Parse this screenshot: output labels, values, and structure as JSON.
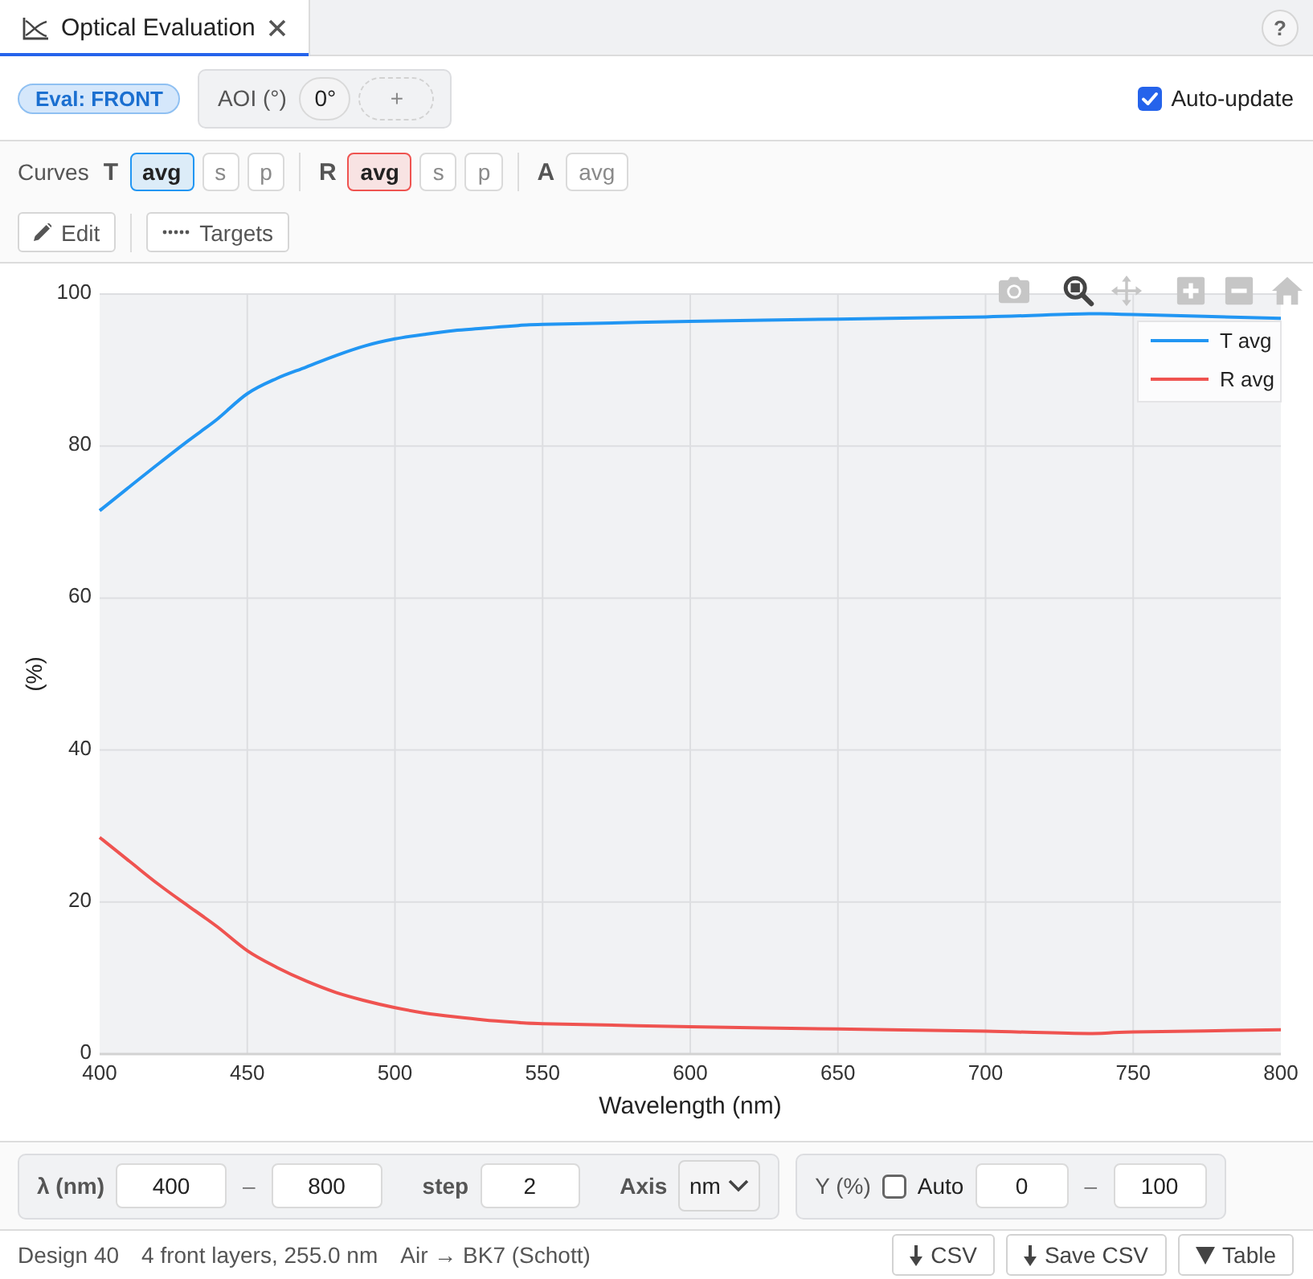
{
  "tabs": [
    {
      "label": "Optical Evaluation",
      "selected": true
    }
  ],
  "help_button": {
    "label": "?"
  },
  "eval_badge": "Eval: FRONT",
  "aoi": {
    "label": "AOI (°)",
    "angles": [
      "0°"
    ],
    "add_label": "+"
  },
  "auto_update": {
    "label": "Auto-update",
    "checked": true
  },
  "curves": {
    "label": "Curves",
    "groups": [
      {
        "name": "T",
        "color": "#2196f3",
        "options": [
          {
            "label": "avg",
            "selected": true
          },
          {
            "label": "s",
            "selected": false
          },
          {
            "label": "p",
            "selected": false
          }
        ]
      },
      {
        "name": "R",
        "color": "#ef5350",
        "options": [
          {
            "label": "avg",
            "selected": true
          },
          {
            "label": "s",
            "selected": false
          },
          {
            "label": "p",
            "selected": false
          }
        ]
      },
      {
        "name": "A",
        "options": [
          {
            "label": "avg",
            "selected": false
          }
        ]
      }
    ]
  },
  "actions": [
    {
      "kind": "edit",
      "label": "Edit"
    },
    {
      "kind": "targets",
      "label": "Targets"
    }
  ],
  "chart": {
    "tools": [
      {
        "kind": "camera",
        "selected": false
      },
      {
        "kind": "zoom",
        "selected": true
      },
      {
        "kind": "pan",
        "selected": false
      },
      {
        "kind": "zoom_in",
        "selected": false
      },
      {
        "kind": "zoom_out",
        "selected": false
      },
      {
        "kind": "home",
        "selected": false
      }
    ],
    "chart_data": {
      "type": "line",
      "xlabel": "Wavelength (nm)",
      "ylabel": "(%)",
      "x": [
        400,
        410,
        420,
        430,
        440,
        450,
        460,
        470,
        480,
        490,
        500,
        510,
        520,
        530,
        540,
        550,
        600,
        650,
        700,
        735,
        750,
        800
      ],
      "series": [
        {
          "name": "T avg",
          "color": "#2196f3",
          "values": [
            71.5,
            74.6,
            77.7,
            80.7,
            83.6,
            86.9,
            88.9,
            90.4,
            91.9,
            93.2,
            94.1,
            94.7,
            95.2,
            95.5,
            95.8,
            96.0,
            96.4,
            96.7,
            97.0,
            97.4,
            97.3,
            96.8
          ]
        },
        {
          "name": "R avg",
          "color": "#ef5350",
          "values": [
            28.5,
            25.4,
            22.3,
            19.5,
            16.7,
            13.6,
            11.4,
            9.6,
            8.1,
            7.0,
            6.1,
            5.4,
            4.9,
            4.5,
            4.2,
            4.0,
            3.6,
            3.3,
            3.0,
            2.7,
            2.9,
            3.2
          ]
        }
      ],
      "xlim": [
        400,
        800
      ],
      "ylim": [
        0,
        100
      ],
      "xticks": [
        {
          "value": 400,
          "label": "400"
        },
        {
          "value": 450,
          "label": "450"
        },
        {
          "value": 500,
          "label": "500"
        },
        {
          "value": 550,
          "label": "550"
        },
        {
          "value": 600,
          "label": "600"
        },
        {
          "value": 650,
          "label": "650"
        },
        {
          "value": 700,
          "label": "700"
        },
        {
          "value": 750,
          "label": "750"
        },
        {
          "value": 800,
          "label": "800"
        }
      ],
      "yticks": [
        {
          "value": 0,
          "label": "0"
        },
        {
          "value": 20,
          "label": "20"
        },
        {
          "value": 40,
          "label": "40"
        },
        {
          "value": 60,
          "label": "60"
        },
        {
          "value": 80,
          "label": "80"
        },
        {
          "value": 100,
          "label": "100"
        }
      ],
      "grid": true,
      "legend": true
    }
  },
  "wavelength": {
    "label": "λ (nm)",
    "from": "400",
    "separator": "–",
    "to": "800",
    "step_label": "step",
    "step": "2",
    "axis_label": "Axis",
    "axis_unit": "nm"
  },
  "y_range": {
    "label": "Y (%)",
    "auto": {
      "label": "Auto",
      "checked": false
    },
    "from": "0",
    "separator": "–",
    "to": "100"
  },
  "status_bar": {
    "items": [
      "Design 40",
      "4 front layers, 255.0 nm",
      "Air → BK7 (Schott)"
    ],
    "buttons": [
      {
        "kind": "download",
        "label": "CSV"
      },
      {
        "kind": "download",
        "label": "Save CSV"
      },
      {
        "kind": "table",
        "label": "Table"
      }
    ]
  }
}
